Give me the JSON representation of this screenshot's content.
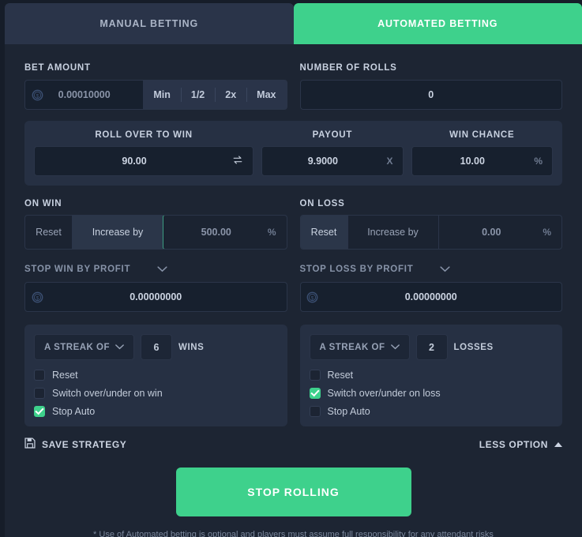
{
  "tabs": [
    {
      "label": "MANUAL BETTING",
      "active": false
    },
    {
      "label": "AUTOMATED BETTING",
      "active": true
    }
  ],
  "bet_amount": {
    "label": "BET AMOUNT",
    "value": "0.00010000",
    "currency_icon": "coin-dollar-icon",
    "quick": [
      "Min",
      "1/2",
      "2x",
      "Max"
    ]
  },
  "number_of_rolls": {
    "label": "NUMBER OF ROLLS",
    "value": "0"
  },
  "odds": {
    "roll_over": {
      "label": "ROLL OVER TO WIN",
      "value": "90.00",
      "suffix_icon": "swap-arrows-icon"
    },
    "payout": {
      "label": "PAYOUT",
      "value": "9.9000",
      "suffix": "X"
    },
    "win_chance": {
      "label": "WIN CHANCE",
      "value": "10.00",
      "suffix": "%"
    }
  },
  "on_win": {
    "label": "ON WIN",
    "reset_label": "Reset",
    "increase_label": "Increase by",
    "selected": "increase",
    "value": "500.00",
    "suffix": "%"
  },
  "on_loss": {
    "label": "ON LOSS",
    "reset_label": "Reset",
    "increase_label": "Increase by",
    "selected": "reset",
    "value": "0.00",
    "suffix": "%"
  },
  "stop_win": {
    "label": "STOP WIN BY PROFIT",
    "value": "0.00000000",
    "currency_icon": "coin-dollar-icon"
  },
  "stop_loss": {
    "label": "STOP LOSS BY PROFIT",
    "value": "0.00000000",
    "currency_icon": "coin-dollar-icon"
  },
  "streak_win": {
    "select_label": "A STREAK OF",
    "count": "6",
    "unit": "WINS",
    "options": [
      {
        "label": "Reset",
        "checked": false
      },
      {
        "label": "Switch over/under on win",
        "checked": false
      },
      {
        "label": "Stop Auto",
        "checked": true
      }
    ]
  },
  "streak_loss": {
    "select_label": "A STREAK OF",
    "count": "2",
    "unit": "LOSSES",
    "options": [
      {
        "label": "Reset",
        "checked": false
      },
      {
        "label": "Switch over/under on loss",
        "checked": true
      },
      {
        "label": "Stop Auto",
        "checked": false
      }
    ]
  },
  "footer": {
    "save_label": "SAVE STRATEGY",
    "save_icon": "floppy-disk-icon",
    "less_label": "LESS OPTION",
    "less_icon": "caret-up-icon",
    "cta_label": "STOP ROLLING",
    "disclaimer": "* Use of Automated betting is optional and players must assume full responsibility for any attendant risks"
  },
  "colors": {
    "accent": "#3ed18c",
    "page_bg": "#1d2533",
    "card_bg": "#263043",
    "input_bg": "#17202e",
    "text": "#c3ccda",
    "muted": "#8793a8"
  }
}
